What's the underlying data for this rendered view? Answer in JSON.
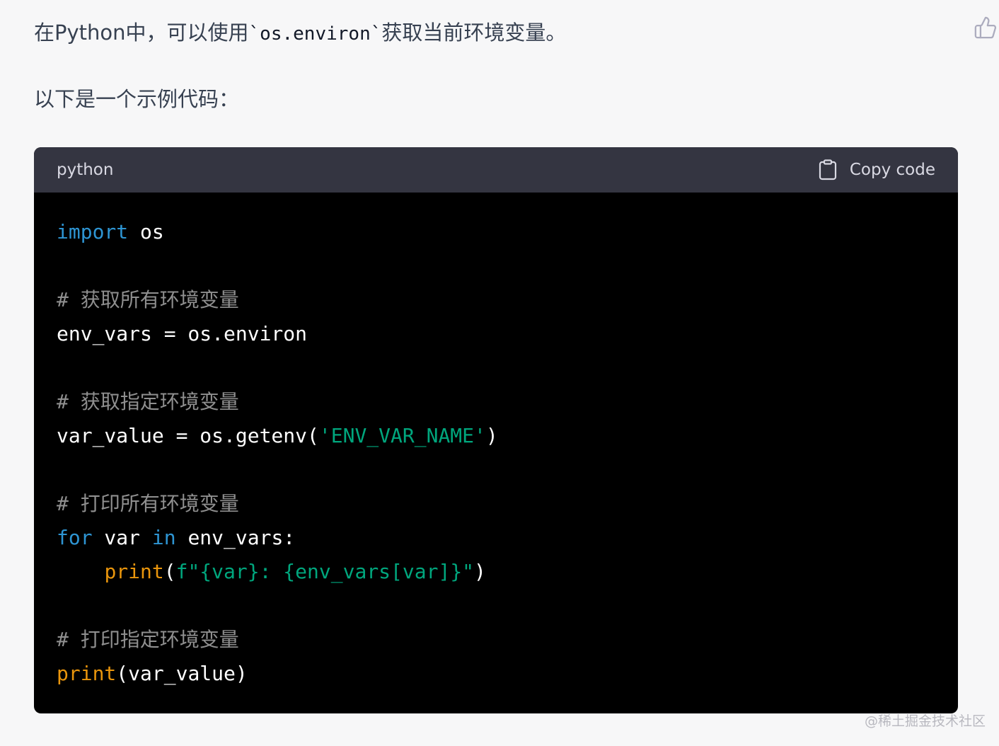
{
  "message": {
    "para1_before": "在Python中，可以使用",
    "para1_code": "`os.environ`",
    "para1_after": "获取当前环境变量。",
    "para2": "以下是一个示例代码："
  },
  "code_block": {
    "language": "python",
    "copy_label": "Copy code",
    "lines": [
      [
        {
          "t": "import",
          "c": "kw"
        },
        {
          "t": " os",
          "c": ""
        }
      ],
      [],
      [
        {
          "t": "# 获取所有环境变量",
          "c": "cm"
        }
      ],
      [
        {
          "t": "env_vars = os.environ",
          "c": ""
        }
      ],
      [],
      [
        {
          "t": "# 获取指定环境变量",
          "c": "cm"
        }
      ],
      [
        {
          "t": "var_value = os.getenv(",
          "c": ""
        },
        {
          "t": "'ENV_VAR_NAME'",
          "c": "str"
        },
        {
          "t": ")",
          "c": ""
        }
      ],
      [],
      [
        {
          "t": "# 打印所有环境变量",
          "c": "cm"
        }
      ],
      [
        {
          "t": "for",
          "c": "kw"
        },
        {
          "t": " var ",
          "c": ""
        },
        {
          "t": "in",
          "c": "kw"
        },
        {
          "t": " env_vars:",
          "c": ""
        }
      ],
      [
        {
          "t": "    ",
          "c": ""
        },
        {
          "t": "print",
          "c": "fn"
        },
        {
          "t": "(",
          "c": ""
        },
        {
          "t": "f\"{var}: {env_vars[var]}\"",
          "c": "str"
        },
        {
          "t": ")",
          "c": ""
        }
      ],
      [],
      [
        {
          "t": "# 打印指定环境变量",
          "c": "cm"
        }
      ],
      [
        {
          "t": "print",
          "c": "fn"
        },
        {
          "t": "(var_value)",
          "c": ""
        }
      ]
    ]
  },
  "watermark": "@稀土掘金技术社区",
  "icons": {
    "feedback": "thumbs-up-icon",
    "copy": "clipboard-icon"
  },
  "colors": {
    "page_bg": "#f7f7f8",
    "code_header_bg": "#343541",
    "code_bg": "#000000",
    "keyword": "#2e95d3",
    "function": "#e9950c",
    "string": "#00a67d",
    "comment": "#8f8f8f"
  }
}
